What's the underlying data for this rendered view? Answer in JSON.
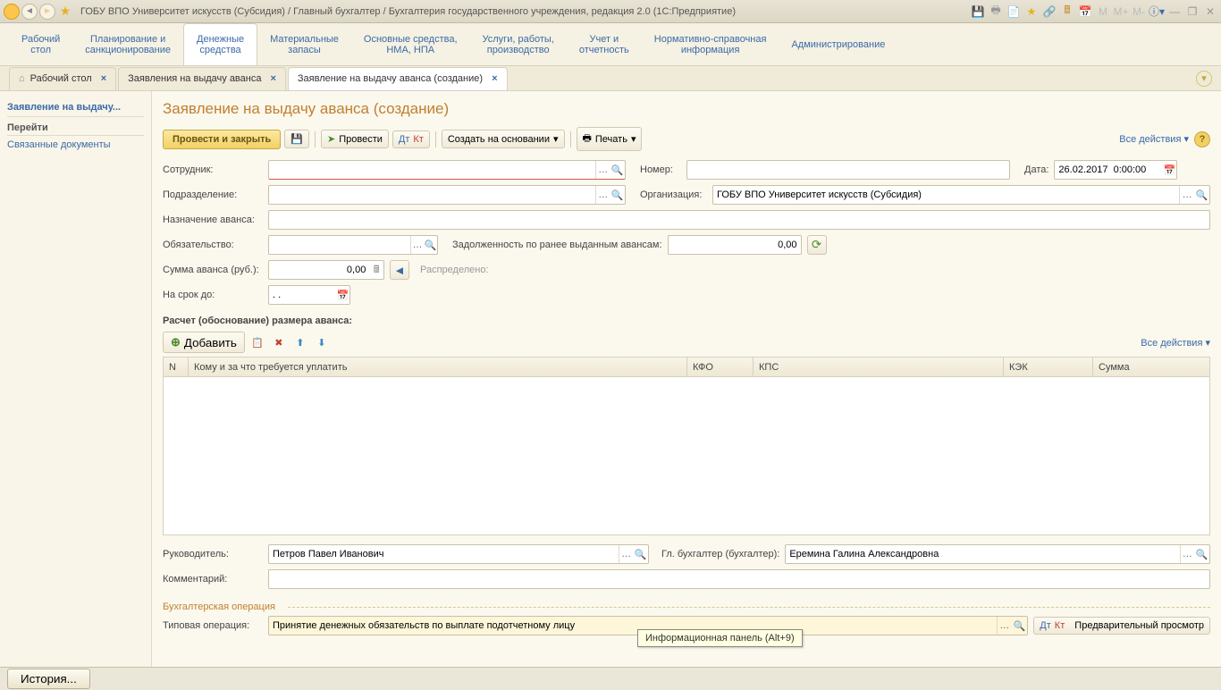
{
  "title_bar": {
    "text": "ГОБУ ВПО Университет искусств (Субсидия) / Главный бухгалтер / Бухгалтерия государственного учреждения, редакция 2.0  (1С:Предприятие)"
  },
  "main_nav": [
    "Рабочий\nстол",
    "Планирование и\nсанкционирование",
    "Денежные\nсредства",
    "Материальные\nзапасы",
    "Основные средства,\nНМА, НПА",
    "Услуги, работы,\nпроизводство",
    "Учет и\nотчетность",
    "Нормативно-справочная\nинформация",
    "Администрирование"
  ],
  "tabs": [
    {
      "label": "Рабочий стол",
      "home": true
    },
    {
      "label": "Заявления на выдачу аванса"
    },
    {
      "label": "Заявление на выдачу аванса (создание)",
      "active": true
    }
  ],
  "sidebar": {
    "header": "Заявление на выдачу...",
    "section": "Перейти",
    "link1": "Связанные документы"
  },
  "page": {
    "title": "Заявление на выдачу аванса (создание)"
  },
  "toolbar": {
    "primary": "Провести и закрыть",
    "post": "Провести",
    "create_based": "Создать на основании",
    "print": "Печать",
    "all_actions": "Все действия"
  },
  "form": {
    "employee_label": "Сотрудник:",
    "number_label": "Номер:",
    "date_label": "Дата:",
    "date_value": "26.02.2017  0:00:00",
    "department_label": "Подразделение:",
    "org_label": "Организация:",
    "org_value": "ГОБУ ВПО Университет искусств (Субсидия)",
    "purpose_label": "Назначение аванса:",
    "obligation_label": "Обязательство:",
    "debt_label": "Задолженность по ранее выданным авансам:",
    "debt_value": "0,00",
    "amount_label": "Сумма аванса (руб.):",
    "amount_value": "0,00",
    "distributed_label": "Распределено:",
    "term_label": "На срок до:",
    "term_value": ". .",
    "calc_title": "Расчет (обоснование) размера аванса:",
    "manager_label": "Руководитель:",
    "manager_value": "Петров Павел Иванович",
    "accountant_label": "Гл. бухгалтер (бухгалтер):",
    "accountant_value": "Еремина Галина Александровна",
    "comment_label": "Комментарий:",
    "fieldset_label": "Бухгалтерская операция",
    "typical_op_label": "Типовая операция:",
    "typical_op_value": "Принятие денежных обязательств по выплате подотчетному лицу",
    "preview_btn": "Предварительный просмотр"
  },
  "table": {
    "add_btn": "Добавить",
    "all_actions": "Все действия",
    "columns": {
      "n": "N",
      "whom": "Кому и за что требуется уплатить",
      "kfo": "КФО",
      "kps": "КПС",
      "kek": "КЭК",
      "sum": "Сумма"
    }
  },
  "status": {
    "history": "История..."
  },
  "tooltip": "Информационная панель (Alt+9)"
}
